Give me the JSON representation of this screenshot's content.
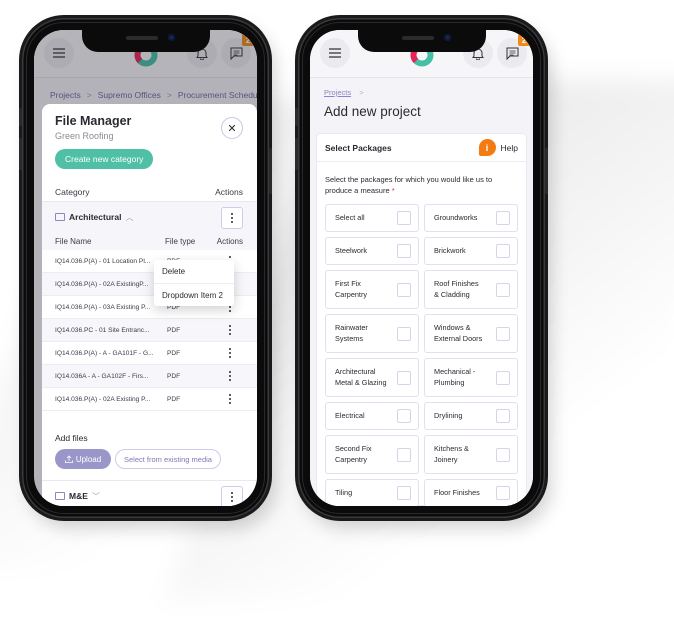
{
  "left_phone": {
    "header": {
      "menu_icon": "hamburger-menu-icon",
      "logo": "app-logo",
      "bell_icon": "bell-icon",
      "chat_icon": "message-icon",
      "chat_badge": "2"
    },
    "breadcrumb": [
      "Projects",
      ">",
      "Supremo Offices",
      ">",
      "Procurement Schedule"
    ],
    "modal": {
      "title": "File Manager",
      "subtitle": "Green Roofing",
      "close_icon": "close-icon",
      "create_button": "Create new category",
      "category_header": "Category",
      "actions_header": "Actions",
      "categories": [
        {
          "name": "Architectural",
          "expanded": true,
          "file_columns": [
            "File Name",
            "File type",
            "Actions"
          ],
          "files": [
            {
              "name": "IQ14.036.P(A) - 01 Location Pl...",
              "type": "PDF"
            },
            {
              "name": "IQ14.036.P(A) - 02A ExistingP...",
              "type": "PDF"
            },
            {
              "name": "IQ14.036.P(A) - 03A Existing P...",
              "type": "PDF"
            },
            {
              "name": "IQ14.036.PC - 01 Site Entranc...",
              "type": "PDF"
            },
            {
              "name": "IQ14.036.P(A) - A - GA101F - G...",
              "type": "PDF"
            },
            {
              "name": "IQ14.036A - A - GA102F - Firs...",
              "type": "PDF"
            },
            {
              "name": "IQ14.036.P(A) - 02A Existing P...",
              "type": "PDF"
            }
          ]
        },
        {
          "name": "M&E",
          "expanded": false
        }
      ],
      "dropdown": [
        "Delete",
        "Dropdown Item 2"
      ],
      "add_files_label": "Add files",
      "upload_button": "Upload",
      "existing_media_button": "Select from existing media"
    }
  },
  "right_phone": {
    "header": {
      "chat_badge": "2"
    },
    "breadcrumb": [
      "Projects",
      ">"
    ],
    "title": "Add new project",
    "card": {
      "title": "Select Packages",
      "help_label": "Help",
      "help_icon_text": "i",
      "intro": "Select the packages for which you would like us to produce a measure",
      "required_mark": "*",
      "packages": [
        {
          "label": "Select all",
          "checked": false
        },
        {
          "label": "Groundworks",
          "checked": false
        },
        {
          "label": "Steelwork",
          "checked": false
        },
        {
          "label": "Brickwork",
          "checked": false
        },
        {
          "label": "First Fix\nCarpentry",
          "checked": false
        },
        {
          "label": "Roof Finishes\n& Cladding",
          "checked": false
        },
        {
          "label": "Rainwater\nSystems",
          "checked": false
        },
        {
          "label": "Windows &\nExternal Doors",
          "checked": false
        },
        {
          "label": "Architectural\nMetal & Glazing",
          "checked": false
        },
        {
          "label": "Mechanical -\nPlumbing",
          "checked": false
        },
        {
          "label": "Electrical",
          "checked": false
        },
        {
          "label": "Drylining",
          "checked": false
        },
        {
          "label": "Second Fix\nCarpentry",
          "checked": false
        },
        {
          "label": "Kitchens &\nJoinery",
          "checked": false
        },
        {
          "label": "Tiling",
          "checked": false
        },
        {
          "label": "Floor Finishes",
          "checked": false
        }
      ]
    }
  },
  "colors": {
    "teal": "#4fbfa6",
    "orange": "#f37b12",
    "purple": "#9b96ca",
    "link_purple": "#8985c6",
    "logo_pink": "#e8235a",
    "logo_teal": "#45bfa6"
  }
}
